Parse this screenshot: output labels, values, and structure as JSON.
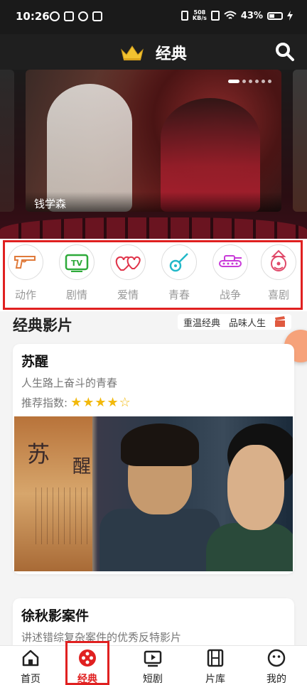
{
  "status_bar": {
    "time": "10:26",
    "net_speed_top": "508",
    "net_speed_bottom": "KB/s",
    "battery": "43%"
  },
  "header": {
    "title": "经典"
  },
  "banner": {
    "caption": "钱学森",
    "slide_count": 6,
    "active_slide": 1
  },
  "categories": [
    {
      "label": "动作",
      "icon": "gun-icon",
      "color": "#e07a3a"
    },
    {
      "label": "剧情",
      "icon": "tv-icon",
      "color": "#2eaa3a"
    },
    {
      "label": "爱情",
      "icon": "hearts-icon",
      "color": "#e0344a"
    },
    {
      "label": "青春",
      "icon": "guitar-icon",
      "color": "#22b8c8"
    },
    {
      "label": "战争",
      "icon": "tank-icon",
      "color": "#c83ad8"
    },
    {
      "label": "喜剧",
      "icon": "clown-icon",
      "color": "#e04a6a"
    }
  ],
  "section": {
    "title": "经典影片",
    "tag1": "重温经典",
    "tag2": "品味人生"
  },
  "cards": [
    {
      "title": "苏醒",
      "subtitle": "人生路上奋斗的青春",
      "rating_label": "推荐指数:",
      "stars": 4,
      "max_stars": 5,
      "poster_text_1": "苏",
      "poster_text_2": "醒"
    },
    {
      "title": "徐秋影案件",
      "subtitle": "讲述错综复杂案件的优秀反特影片"
    }
  ],
  "bottom_nav": [
    {
      "label": "首页",
      "icon": "home-icon"
    },
    {
      "label": "经典",
      "icon": "film-reel-icon",
      "active": true
    },
    {
      "label": "短剧",
      "icon": "play-icon"
    },
    {
      "label": "片库",
      "icon": "filmstrip-icon"
    },
    {
      "label": "我的",
      "icon": "profile-icon"
    }
  ],
  "colors": {
    "accent": "#e02020",
    "star": "#f2b90c",
    "header_bg": "#1f1f1f"
  }
}
